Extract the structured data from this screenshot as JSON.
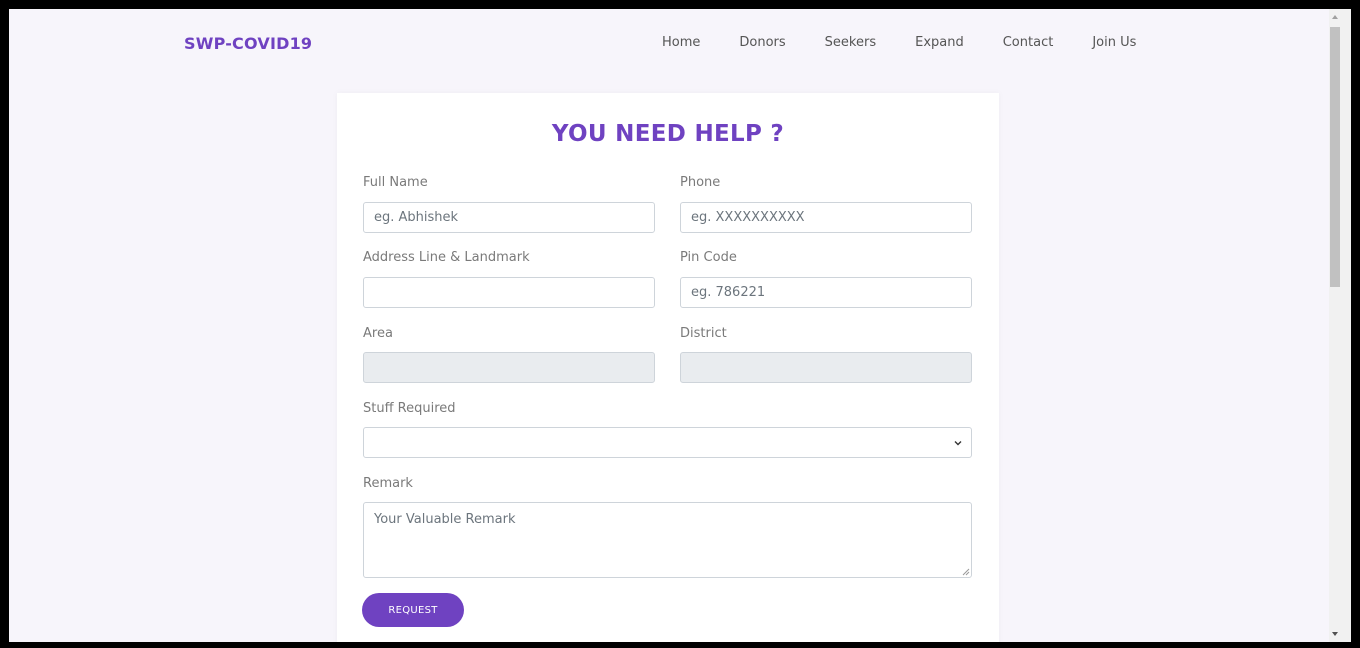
{
  "navbar": {
    "brand": "SWP-COVID19",
    "links": [
      "Home",
      "Donors",
      "Seekers",
      "Expand",
      "Contact",
      "Join Us"
    ]
  },
  "form": {
    "title": "YOU NEED HELP ?",
    "full_name": {
      "label": "Full Name",
      "placeholder": "eg. Abhishek",
      "value": ""
    },
    "phone": {
      "label": "Phone",
      "placeholder": "eg. XXXXXXXXXX",
      "value": ""
    },
    "address": {
      "label": "Address Line & Landmark",
      "placeholder": "",
      "value": ""
    },
    "pin_code": {
      "label": "Pin Code",
      "placeholder": "eg. 786221",
      "value": ""
    },
    "area": {
      "label": "Area",
      "value": ""
    },
    "district": {
      "label": "District",
      "value": ""
    },
    "stuff_required": {
      "label": "Stuff Required",
      "selected": ""
    },
    "remark": {
      "label": "Remark",
      "placeholder": "Your Valuable Remark",
      "value": ""
    },
    "submit_label": "REQUEST"
  },
  "colors": {
    "accent": "#6f42c1",
    "page_bg": "#f7f5fb",
    "disabled_field": "#e9ecef"
  }
}
